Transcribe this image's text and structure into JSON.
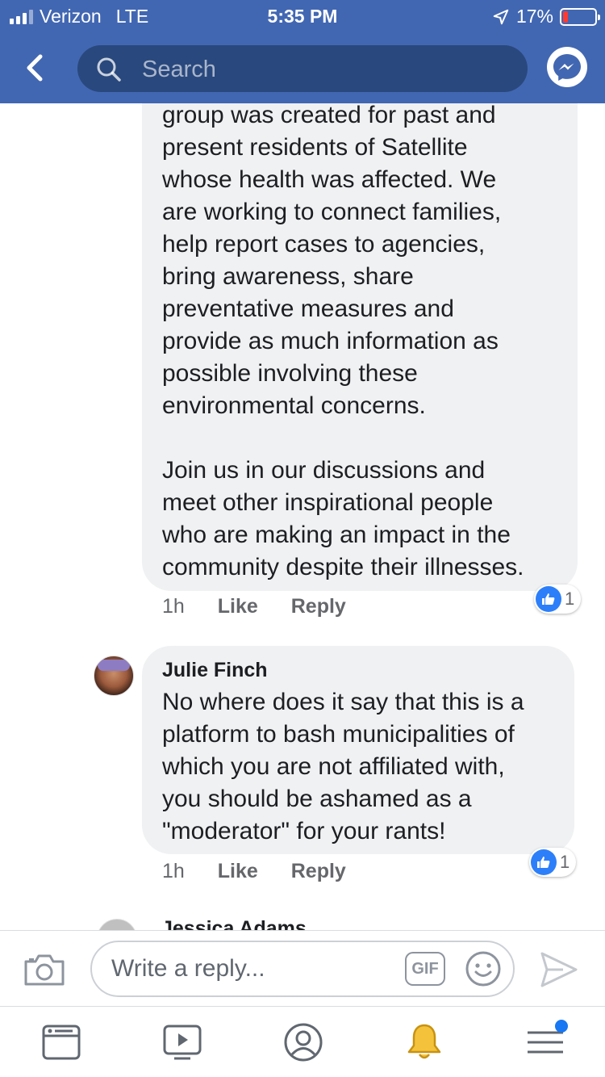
{
  "status_bar": {
    "carrier": "Verizon",
    "network": "LTE",
    "time": "5:35 PM",
    "battery_percent_label": "17%",
    "battery_level": 0.17,
    "signal_bars": 3
  },
  "header": {
    "search_placeholder": "Search",
    "icons": [
      "back-icon",
      "search-icon",
      "messenger-icon"
    ]
  },
  "comments": [
    {
      "text": "group was created for past and\npresent residents of Satellite\nwhose health was affected.  We\nare working to connect families,\nhelp report cases to agencies,\nbring awareness, share\npreventative measures and\nprovide as much information as\npossible involving these\nenvironmental concerns.\n\nJoin us in our discussions and\nmeet other inspirational people\nwho are making an impact in the\ncommunity despite their illnesses.",
      "time": "1h",
      "like_label": "Like",
      "reply_label": "Reply",
      "reaction_count": "1"
    },
    {
      "author": "Julie Finch",
      "text": "No where does it say that this is a\nplatform to bash municipalities of\nwhich you are not affiliated with,\nyou should be ashamed as a\n\"moderator\" for your rants!",
      "time": "1h",
      "like_label": "Like",
      "reply_label": "Reply",
      "reaction_count": "1"
    },
    {
      "author": "Jessica Adams"
    }
  ],
  "composer": {
    "placeholder": "Write a reply...",
    "gif_label": "GIF",
    "icons": [
      "camera-icon",
      "gif-icon",
      "emoji-icon",
      "send-icon"
    ]
  },
  "tab_bar": {
    "tabs": [
      "news-feed-icon",
      "watch-icon",
      "profile-icon",
      "notifications-icon",
      "menu-icon"
    ],
    "notification_color": "#f5c33b",
    "badge_color": "#1877f2"
  },
  "colors": {
    "header_bg": "#4267b2",
    "search_bg": "#29487d",
    "bubble_bg": "#f0f1f3",
    "like_blue": "#2d7ff9"
  }
}
